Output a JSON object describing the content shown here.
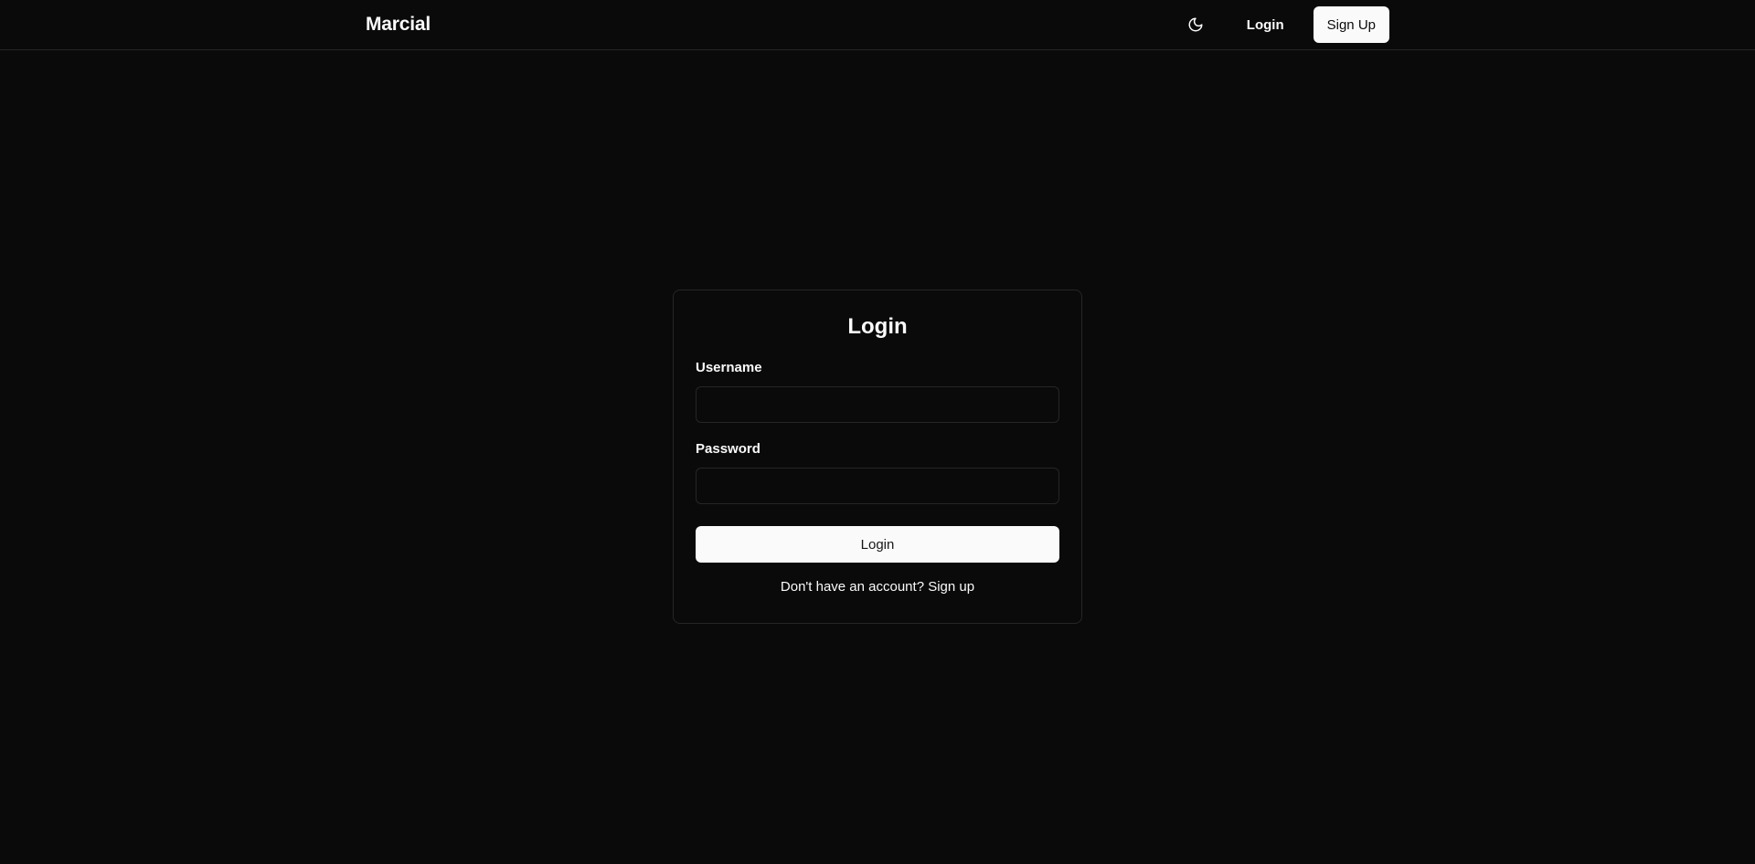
{
  "header": {
    "brand": "Marcial",
    "theme_toggle_icon": "moon-icon",
    "login_label": "Login",
    "signup_label": "Sign Up"
  },
  "login_card": {
    "title": "Login",
    "username_label": "Username",
    "username_value": "",
    "password_label": "Password",
    "password_value": "",
    "submit_label": "Login",
    "signup_prompt": "Don't have an account?",
    "signup_link": "Sign up"
  },
  "colors": {
    "background": "#0a0a0a",
    "foreground": "#fafafa",
    "border": "#262626",
    "primary_button_bg": "#fafafa",
    "primary_button_text": "#171717"
  }
}
